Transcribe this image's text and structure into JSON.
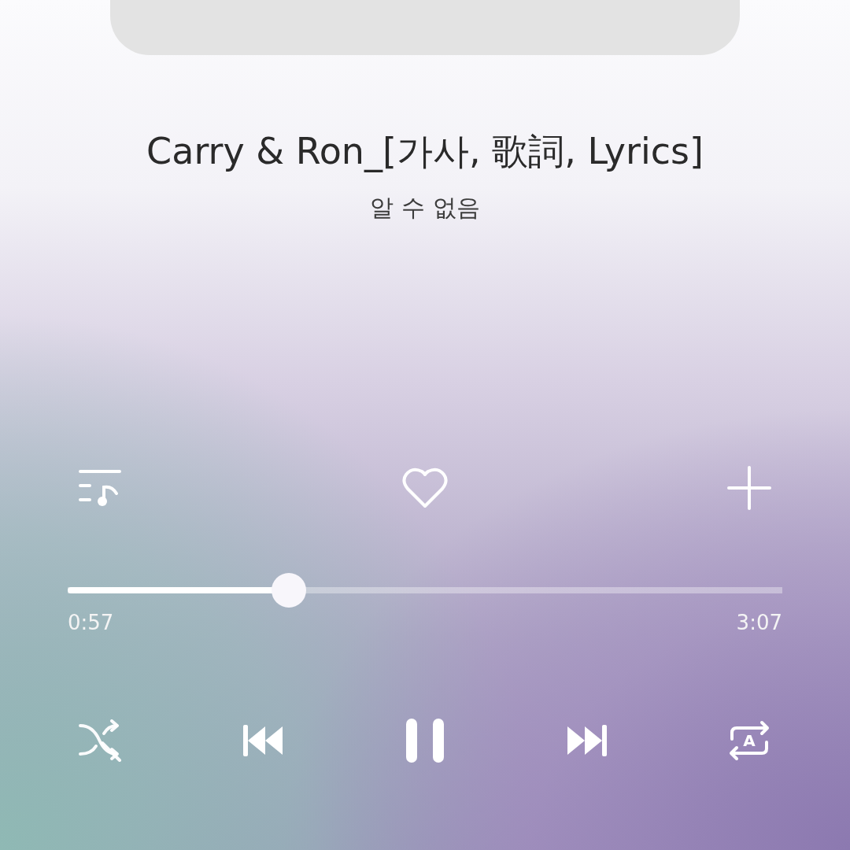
{
  "song": {
    "title": "Carry & Ron_[가사, 歌詞, Lyrics]",
    "artist": "알 수 없음"
  },
  "actions": {
    "liked": false
  },
  "progress": {
    "level": 0.31,
    "elapsed": "0:57",
    "duration": "3:07"
  },
  "controls": {
    "shuffle": false,
    "playing": true,
    "repeat_mode_label": "A"
  }
}
